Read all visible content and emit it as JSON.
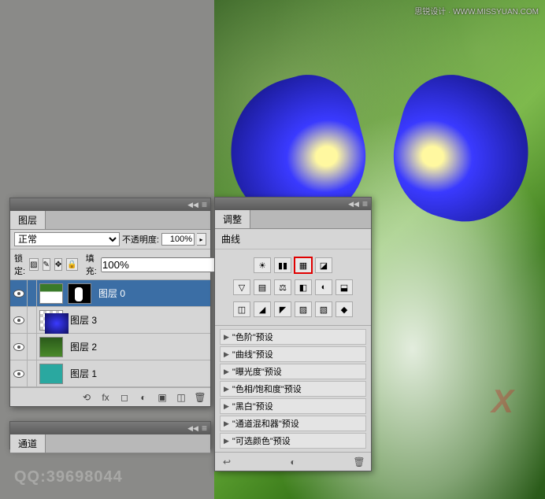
{
  "watermarks": {
    "top": "思锐设计 · WWW.MISSYUAN.COM",
    "x": "X",
    "qq": "QQ:39698044"
  },
  "layers_panel": {
    "tab": "图层",
    "blend_mode": "正常",
    "opacity_label": "不透明度:",
    "opacity_value": "100%",
    "lock_label": "锁定:",
    "fill_label": "填充:",
    "fill_value": "100%",
    "layers": [
      {
        "name": "图层 0",
        "selected": true,
        "thumb": "dress",
        "mask": true
      },
      {
        "name": "图层 3",
        "selected": false,
        "thumb": "wing",
        "mask": false,
        "checker": true
      },
      {
        "name": "图层 2",
        "selected": false,
        "thumb": "forest",
        "mask": false
      },
      {
        "name": "图层 1",
        "selected": false,
        "thumb": "teal",
        "mask": false
      }
    ]
  },
  "channels_panel": {
    "tab": "通道"
  },
  "adjust_panel": {
    "tab": "调整",
    "title": "曲线",
    "icons_row1": [
      "☀",
      "▮▮",
      "▦",
      "◪"
    ],
    "icons_row2": [
      "▽",
      "▤",
      "⚖",
      "◧",
      "◐",
      "⬓"
    ],
    "icons_row3": [
      "◫",
      "◢",
      "◤",
      "▨",
      "▧",
      "◆"
    ],
    "highlighted_index": 2,
    "presets": [
      "\"色阶\"预设",
      "\"曲线\"预设",
      "\"曝光度\"预设",
      "\"色相/饱和度\"预设",
      "\"黑白\"预设",
      "\"通道混和器\"预设",
      "\"可选颜色\"预设"
    ]
  }
}
